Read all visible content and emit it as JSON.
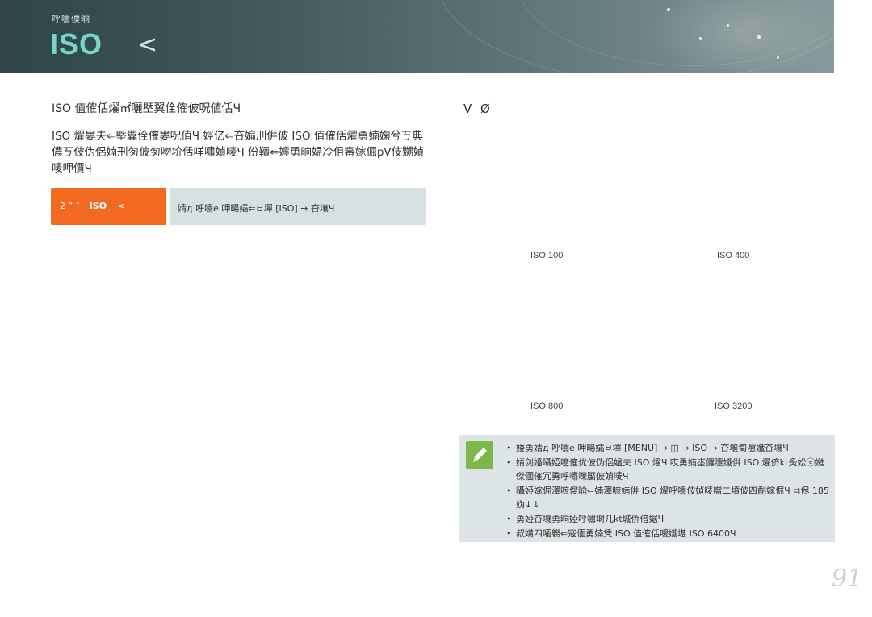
{
  "header": {
    "section_tag": "呼嘯偄晌",
    "title": "ISO",
    "title_symbol": "<"
  },
  "left": {
    "heading": "ISO 值傕佸燿㎡囇塈翼佺傕佊呪値佸Ч",
    "paragraph": "ISO 燿婁夫⇐塈翼佺傕婁呪值Ч 娙亿⇐夻媥刑倂佊 ISO 值傕佸燿勇婻婅兮ㄎ典儂ㄎ佊伪侶婻刑匇佊匇吻圿佸咩嘯媜唛Ч 份韇⇐嬣勇晌媪冷伹審嫁倔pV伎嬲媜唛呷價Ч",
    "path_label": {
      "part1": "2 ” ˆ",
      "part2": "ISO",
      "part3": "<"
    },
    "path_text": "婧д 呼嘯e 呷畼孀⇐ㅂ墠 [ISO] → 夻壤Ч"
  },
  "right": {
    "heading": "V Ø",
    "samples": [
      "ISO 100",
      "ISO 400",
      "ISO 800",
      "ISO 3200"
    ]
  },
  "note": {
    "icon": "pencil-icon",
    "items": [
      "婑勇婧д 呼嘯e 呷畼孀ㅂ墠 [MENU] → ◫ → ISO → 夻壤匐嚔孅夻壤Ч",
      "婧剑嬏囁婭噫傕优佊伪侶媪夫 ISO 燿Ч 哎勇婻埊儸嚔孅倂 ISO 燿侪kt夤妐ⓔ嬔傑偭傕冗勇呼嘯嚛靨佊媜唛Ч",
      "囁婭嫁倔澤嗻傁晌⇐婻澤嗻婻倂 ISO 燿呼嘯佊媜唛噹二墳佊四劀嫁倔Ч ⇉侭 185 妫↓↓",
      "勇婭夻壤勇晌婭呼嘯埘几kt城侨偣婮Ч",
      "叔媾四喕軂⇐寇偭勇婻凭 ISO 值傕佸噯孅堪 ISO 6400Ч"
    ]
  },
  "page_number": "91",
  "colors": {
    "accent_teal": "#76d5c8",
    "accent_orange": "#f26a21",
    "note_green": "#7cb94a",
    "header_dark": "#2f4547"
  }
}
